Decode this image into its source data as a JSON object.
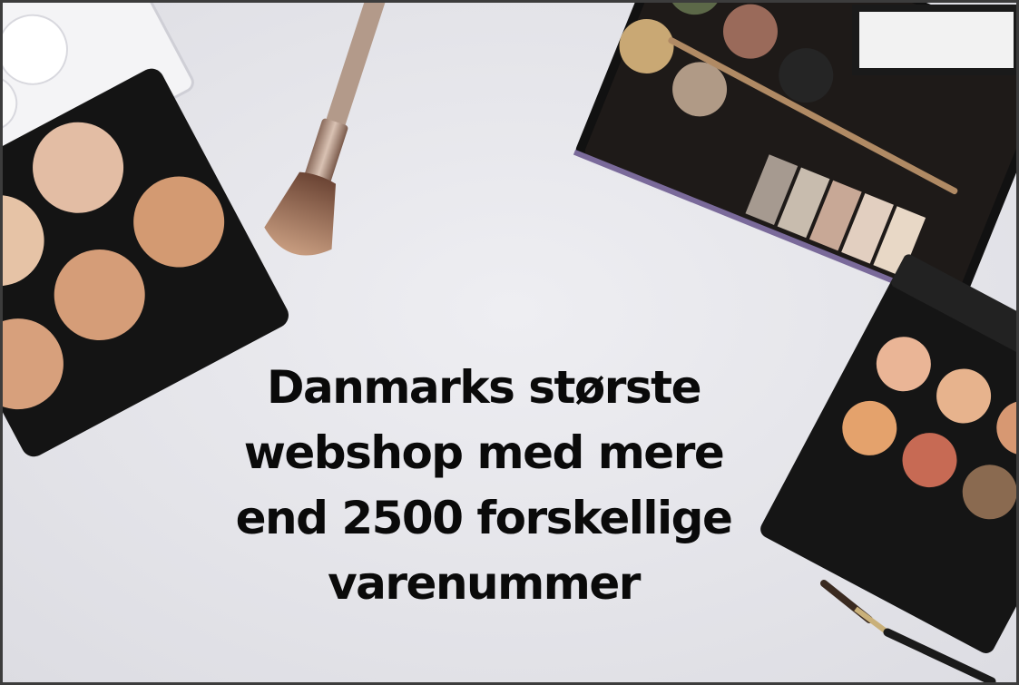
{
  "headline": {
    "lines": [
      "Danmarks største",
      "webshop med mere",
      "end 2500 forskellige",
      "varenummer"
    ]
  },
  "objects": {
    "left_palette": "contour-palette",
    "brush": "makeup-brush",
    "top_palette": "eyeshadow-palette",
    "right_palette": "eyeshadow-palette-small",
    "small_brush": "eyeliner-brush"
  },
  "colors": {
    "background": "#e9e9ee",
    "headline": "#0a0a0a",
    "palette_case": "#141414"
  }
}
